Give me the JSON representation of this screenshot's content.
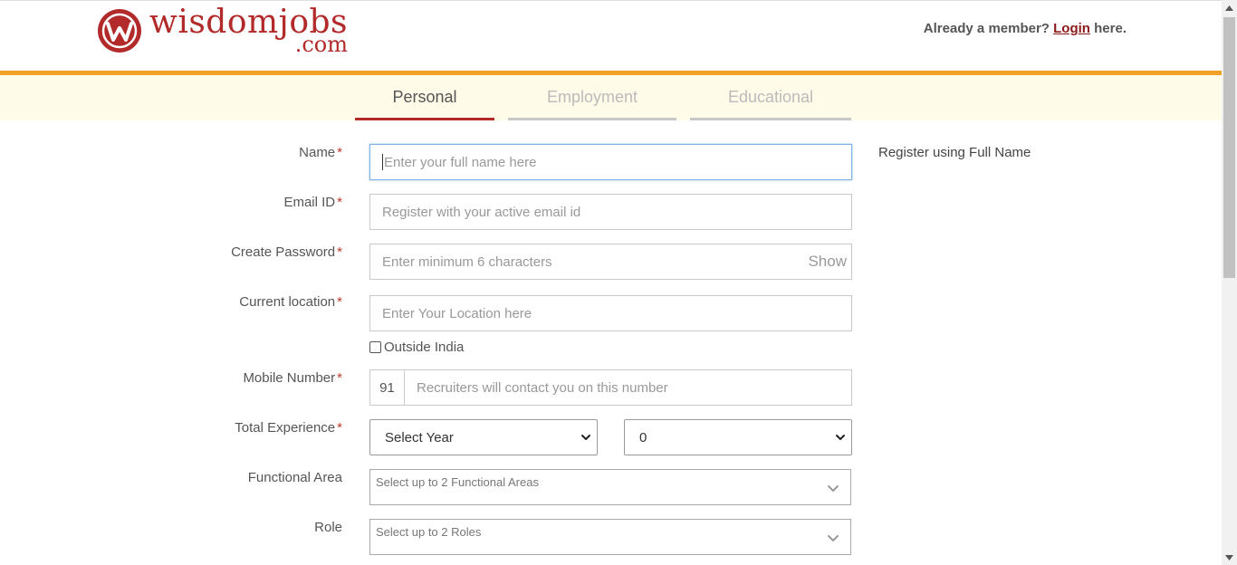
{
  "brand": {
    "name": "wisdomjobs",
    "suffix": ".com",
    "color": "#b22a2a"
  },
  "header": {
    "member_prefix": "Already a member?",
    "login_label": "Login",
    "member_suffix": "here."
  },
  "tabs": [
    {
      "label": "Personal",
      "active": true
    },
    {
      "label": "Employment",
      "active": false
    },
    {
      "label": "Educational",
      "active": false
    }
  ],
  "form": {
    "name": {
      "label": "Name",
      "required": "*",
      "placeholder": "Enter your full name here"
    },
    "email": {
      "label": "Email ID",
      "required": "*",
      "placeholder": "Register with your active email id"
    },
    "password": {
      "label": "Create Password",
      "required": "*",
      "placeholder": "Enter minimum 6 characters",
      "show_label": "Show"
    },
    "location": {
      "label": "Current location",
      "required": "*",
      "placeholder": "Enter Your Location here"
    },
    "outside_india": {
      "label": "Outside India",
      "checked": false
    },
    "mobile": {
      "label": "Mobile Number",
      "required": "*",
      "country_code": "91",
      "placeholder": "Recruiters will contact you on this number"
    },
    "experience": {
      "label": "Total Experience",
      "required": "*",
      "year_value": "Select Year",
      "month_value": "0"
    },
    "functional_area": {
      "label": "Functional Area",
      "placeholder": "Select up to 2 Functional Areas"
    },
    "role": {
      "label": "Role",
      "placeholder": "Select up to 2 Roles"
    }
  },
  "hint": "Register using Full Name",
  "colors": {
    "accent_bar": "#f0a126",
    "tab_active": "#b22a2a",
    "strip_bg": "#fefbe9"
  }
}
